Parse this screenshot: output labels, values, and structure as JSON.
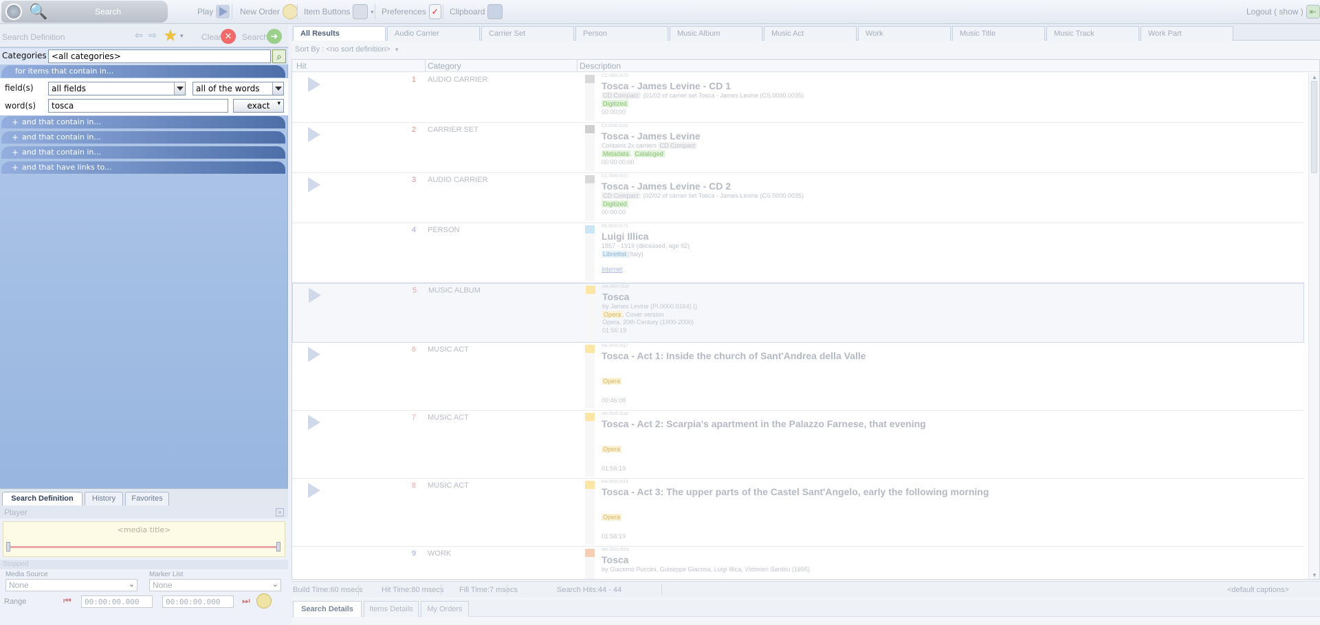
{
  "toolbar": {
    "search_label": "Search",
    "play_label": "Play",
    "new_order_label": "New Order",
    "item_buttons_label": "Item Buttons",
    "preferences_label": "Preferences",
    "clipboard_label": "Clipboard",
    "logout_label": "Logout ( show )"
  },
  "search_definition": {
    "title": "Search Definition",
    "clear_label": "Clear",
    "search_label": "Search",
    "categories_label": "Categories",
    "categories_value": "<all categories>",
    "for_items_label": "for items that contain in...",
    "fields_label": "field(s)",
    "fields_value": "all fields",
    "match_value": "all of the words",
    "words_label": "word(s)",
    "words_value": "tosca",
    "exact_label": "exact",
    "bands": [
      "and that contain in...",
      "and that contain in...",
      "and that contain in...",
      "and that have links to..."
    ],
    "band_plus": "+"
  },
  "left_tabs": [
    "Search Definition",
    "History",
    "Favorites"
  ],
  "player": {
    "title": "Player",
    "collapse_icon": "»",
    "media_title": "<media title>",
    "status": "Stopped",
    "media_source_label": "Media Source",
    "media_source_value": "None",
    "marker_list_label": "Marker List",
    "marker_list_value": "None",
    "range_label": "Range",
    "range_start": "00:00:00.000",
    "range_end": "00:00:00.000",
    "select_caret": "⌄"
  },
  "result_tabs": [
    "All Results",
    "Audio Carrier",
    "Carrier Set",
    "Person",
    "Music Album",
    "Music Act",
    "Work",
    "Music Title",
    "Music Track",
    "Work Part"
  ],
  "sort_label": "Sort By :  <no sort definition>",
  "grid_headers": {
    "hit": "Hit",
    "category": "Category",
    "description": "Description"
  },
  "results": [
    {
      "num": "1",
      "num_color": "#e28b8b",
      "category": "AUDIO CARRIER",
      "code": "CC.0000.0073",
      "title": "Tosca - James Levine - CD 1",
      "line1_tag": "CD Compact",
      "line1_text": ": (01/02 of carrier set Tosca - James Levine (CS.0000.0035)",
      "tags": [
        "Digitized"
      ],
      "time": "00:00:00",
      "strip": "#d8d8d8",
      "play": true
    },
    {
      "num": "2",
      "num_color": "#e28b8b",
      "category": "CARRIER SET",
      "code": "CS.0000.0035",
      "title": "Tosca - James Levine",
      "line1_tag": "CD Compact",
      "line1_text": "Contains 2x carriers",
      "tags": [
        "Metadata",
        "Cataloged"
      ],
      "time": "00:00:00:00",
      "strip": "#cfcfcf",
      "play": true
    },
    {
      "num": "3",
      "num_color": "#e28b8b",
      "category": "AUDIO CARRIER",
      "code": "CC.0000.0071",
      "title": "Tosca - James Levine - CD 2",
      "line1_tag": "CD Compact",
      "line1_text": ": (02/02 of carrier set Tosca - James Levine (CS.0000.0035)",
      "tags": [
        "Digitized"
      ],
      "time": "00:00:00",
      "strip": "#d8d8d8",
      "play": true
    },
    {
      "num": "4",
      "num_color": "#9aa6e0",
      "category": "PERSON",
      "code": "PE.0000.0173",
      "title": "Luigi Illica",
      "line1_tag": "",
      "line1_text": "1857 - 1919 (deceased, age 62)",
      "tags": [
        "Librettist"
      ],
      "tag_extra": "(Italy)",
      "link": "Internet",
      "time": "",
      "strip": "#cbe6f4",
      "play": false
    },
    {
      "num": "5",
      "num_color": "#e9a5a5",
      "category": "MUSIC ALBUM",
      "code": "MA.0000.0116",
      "title": "Tosca",
      "line1_tag": "",
      "line1_text": "by James Levine (PI.0000.0164) ()",
      "tags": [
        "Opera"
      ],
      "tag_extra": ", Cover version",
      "line3": "Opera, 20th Century (1900-2000)",
      "time": "01:56:19",
      "strip": "#fbe6a6",
      "play": true
    },
    {
      "num": "6",
      "num_color": "#e9a5a5",
      "category": "MUSIC ACT",
      "code": "MA.0000.0117",
      "title": "Tosca - Act 1: Inside the church of Sant'Andrea della Valle",
      "line1_tag": "",
      "line1_text": "",
      "tags": [
        "Opera"
      ],
      "time": "00:46:08",
      "strip": "#fbe6a6",
      "play": true
    },
    {
      "num": "7",
      "num_color": "#e9a5a5",
      "category": "MUSIC ACT",
      "code": "MA.0000.0118",
      "title": "Tosca - Act 2: Scarpia's apartment in the Palazzo Farnese, that evening",
      "line1_tag": "",
      "line1_text": "",
      "tags": [
        "Opera"
      ],
      "time": "01:56:19",
      "strip": "#fbe6a6",
      "play": true
    },
    {
      "num": "8",
      "num_color": "#e9a5a5",
      "category": "MUSIC ACT",
      "code": "MA.0000.0119",
      "title": "Tosca - Act 3: The upper parts of the Castel Sant'Angelo, early the following morning",
      "line1_tag": "",
      "line1_text": "",
      "tags": [
        "Opera"
      ],
      "time": "01:56:19",
      "strip": "#fbe6a6",
      "play": true
    },
    {
      "num": "9",
      "num_color": "#9aa6e0",
      "category": "WORK",
      "code": "WK.0000.0008",
      "title": "Tosca",
      "line1_tag": "",
      "line1_text": "by Giacomo Puccini, Guiseppe Giacosa, Luigi Illica, Victorien Sardou (1895)",
      "tags": [],
      "time": "",
      "strip": "#f7cdb3",
      "play": false
    }
  ],
  "status_bar": {
    "build": "Build Time:60 msecs",
    "hit": "Hit Time:80 msecs",
    "fill": "Fill Time:7 msecs",
    "hits": "Search Hits:44 - 44",
    "captions": "<default captions>"
  },
  "bottom_tabs": [
    "Search Details",
    "Items Details",
    "My Orders"
  ],
  "icons": {
    "scroll_up": "▲",
    "scroll_down": "▼",
    "nav_back": "⇦",
    "nav_forward": "⇨",
    "star": "★",
    "star_caret": "▾",
    "clear": "✕",
    "search_go": "➜",
    "magnifier": "🔍",
    "search_button": "⌕",
    "item_caret": "▾",
    "sort_caret": "▾",
    "exact_caret": "▾",
    "checkmark": "✓",
    "logout": "⇤",
    "range_start": "⏮",
    "range_end": "⏭"
  }
}
